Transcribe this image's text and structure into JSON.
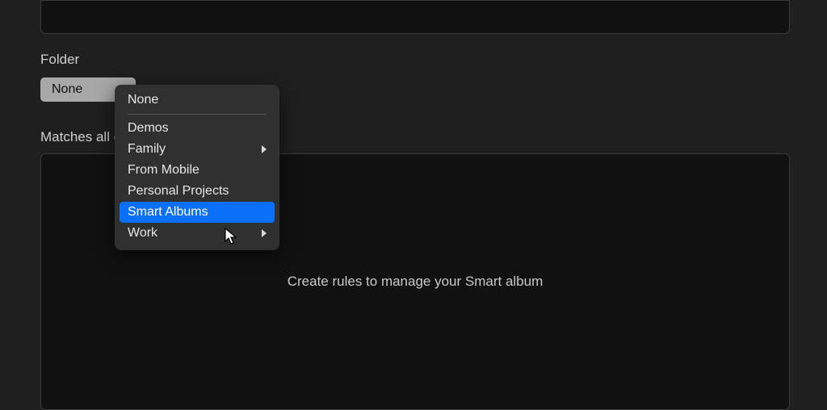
{
  "folder": {
    "label": "Folder",
    "selected": "None"
  },
  "matches_label": "Matches all of the following rules",
  "placeholder": "Create rules to manage your Smart album",
  "dropdown": {
    "items": [
      {
        "label": "None",
        "has_submenu": false,
        "highlight": false,
        "separator_after": true
      },
      {
        "label": "Demos",
        "has_submenu": false,
        "highlight": false,
        "separator_after": false
      },
      {
        "label": "Family",
        "has_submenu": true,
        "highlight": false,
        "separator_after": false
      },
      {
        "label": "From Mobile",
        "has_submenu": false,
        "highlight": false,
        "separator_after": false
      },
      {
        "label": "Personal Projects",
        "has_submenu": false,
        "highlight": false,
        "separator_after": false
      },
      {
        "label": "Smart Albums",
        "has_submenu": false,
        "highlight": true,
        "separator_after": false
      },
      {
        "label": "Work",
        "has_submenu": true,
        "highlight": false,
        "separator_after": false
      }
    ]
  }
}
